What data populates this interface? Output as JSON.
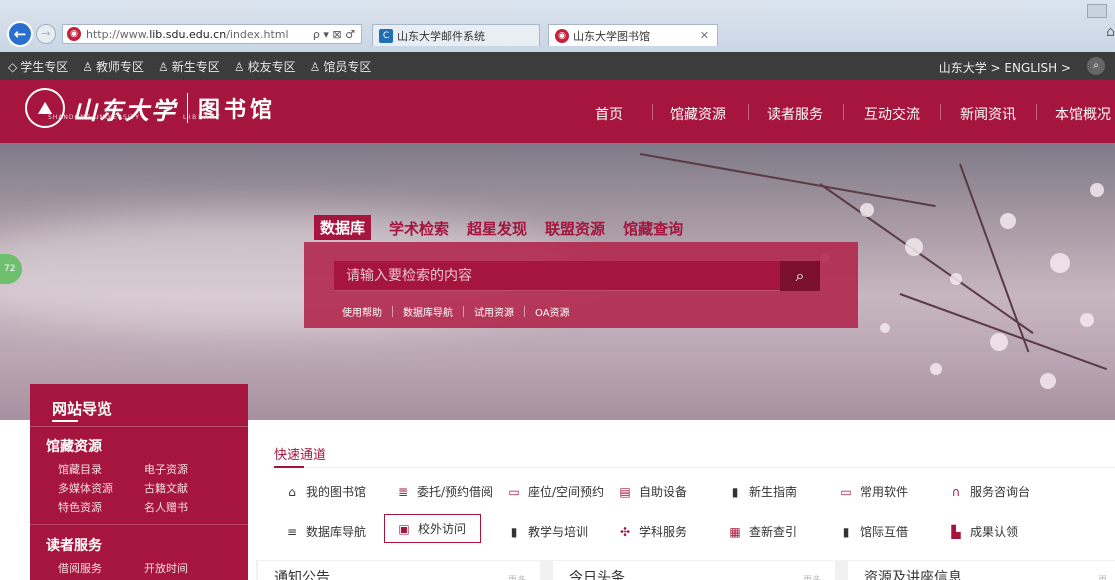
{
  "browser": {
    "url_prefix": "http://www.",
    "url_domain": "lib.sdu.edu.cn",
    "url_suffix": "/index.html",
    "url_icons": "ρ ▾ ⊠ ♂",
    "tabs": [
      {
        "label": "山东大学邮件系统",
        "active": false
      },
      {
        "label": "山东大学图书馆",
        "active": true
      }
    ]
  },
  "topbar": {
    "items": [
      "学生专区",
      "教师专区",
      "新生专区",
      "校友专区",
      "馆员专区"
    ],
    "right_text": "山东大学 >  ENGLISH >"
  },
  "header": {
    "logo_calligraphy": "山东大学",
    "logo_sub": "SHANDONG UNIVERSITY",
    "library": "图书馆",
    "library_sub": "LIBRARY",
    "nav": [
      "首页",
      "馆藏资源",
      "读者服务",
      "互动交流",
      "新闻资讯",
      "本馆概况"
    ]
  },
  "search": {
    "tabs": [
      "数据库",
      "学术检索",
      "超星发现",
      "联盟资源",
      "馆藏查询"
    ],
    "active_tab": "数据库",
    "placeholder": "请输入要检索的内容",
    "links": [
      "使用帮助",
      "数据库导航",
      "试用资源",
      "OA资源"
    ]
  },
  "side_badge": "72",
  "sidenav": {
    "title": "网站导览",
    "categories": [
      {
        "name": "馆藏资源",
        "items": [
          "馆藏目录",
          "电子资源",
          "多媒体资源",
          "古籍文献",
          "特色资源",
          "名人赠书"
        ]
      },
      {
        "name": "读者服务",
        "items": [
          "借阅服务",
          "开放时间"
        ]
      }
    ]
  },
  "quick": {
    "title": "快速通道",
    "row1": [
      "我的图书馆",
      "委托/预约借阅",
      "座位/空间预约",
      "自助设备",
      "新生指南",
      "常用软件",
      "服务咨询台"
    ],
    "row2": [
      "数据库导航",
      "校外访问",
      "教学与培训",
      "学科服务",
      "查新查引",
      "馆际互借",
      "成果认领"
    ]
  },
  "panels": [
    {
      "title": "通知公告",
      "more": "更多"
    },
    {
      "title": "今日头条",
      "more": "更多"
    },
    {
      "title": "资源及讲座信息",
      "more": "更多"
    }
  ],
  "colors": {
    "brand": "#a5153d",
    "topbar": "#3c3c3c"
  }
}
